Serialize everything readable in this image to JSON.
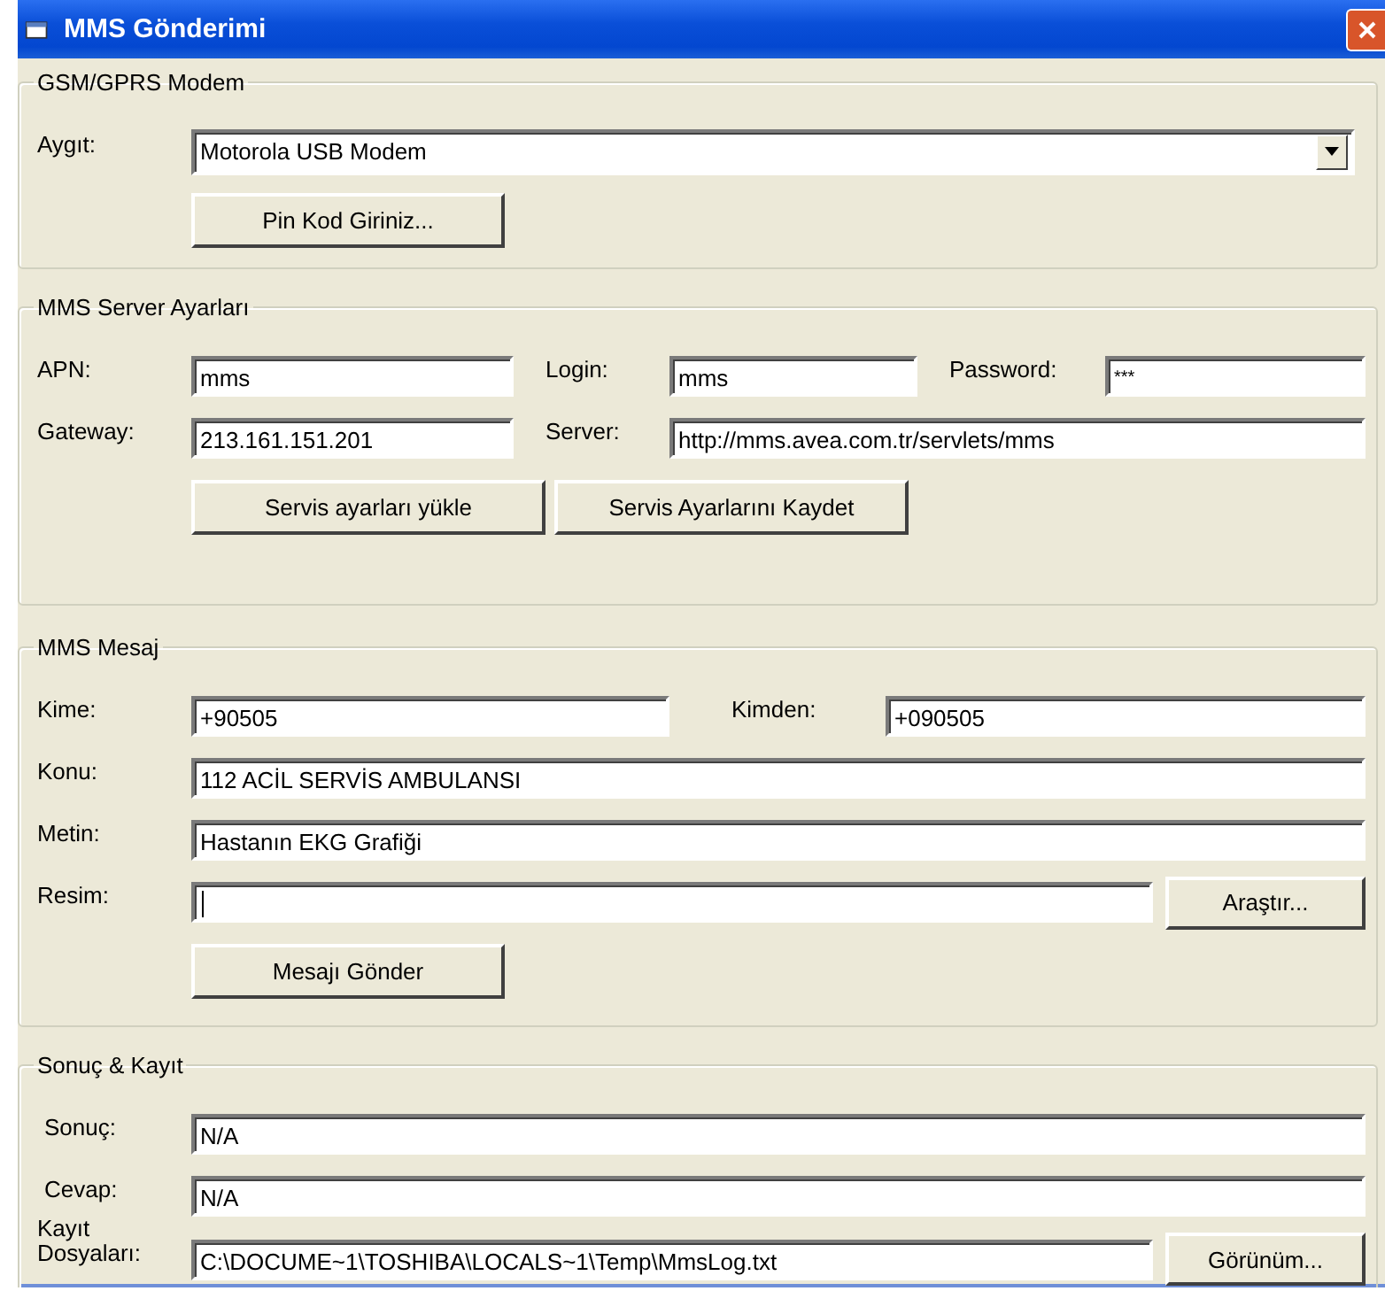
{
  "window": {
    "title": "MMS Gönderimi"
  },
  "modem": {
    "legend": "GSM/GPRS Modem",
    "device_label": "Aygıt:",
    "device_value": "Motorola USB Modem",
    "pin_button": "Pin Kod Giriniz..."
  },
  "server": {
    "legend": "MMS Server Ayarları",
    "apn": {
      "label": "APN:",
      "value": "mms"
    },
    "login": {
      "label": "Login:",
      "value": "mms"
    },
    "password": {
      "label": "Password:",
      "value": "***"
    },
    "gateway": {
      "label": "Gateway:",
      "value": "213.161.151.201"
    },
    "server_url": {
      "label": "Server:",
      "value": "http://mms.avea.com.tr/servlets/mms"
    },
    "buttons": [
      "Servis ayarları yükle",
      "Servis Ayarlarını Kaydet"
    ]
  },
  "message": {
    "legend": "MMS Mesaj",
    "to": {
      "label": "Kime:",
      "value": "+90505"
    },
    "from": {
      "label": "Kimden:",
      "value": "+090505"
    },
    "subject": {
      "label": "Konu:",
      "value": "112 ACİL SERVİS AMBULANSI"
    },
    "text": {
      "label": "Metin:",
      "value": "Hastanın EKG Grafiği"
    },
    "image": {
      "label": "Resim:",
      "focused": true,
      "button": "Araştır..."
    },
    "send_button": "Mesajı Gönder"
  },
  "result": {
    "legend": "Sonuç & Kayıt",
    "result": {
      "label": "Sonuç:",
      "value": "N/A"
    },
    "reply": {
      "label": "Cevap:",
      "value": "N/A"
    },
    "log": {
      "label": "Kayıt Dosyaları:",
      "value": "C:\\DOCUME~1\\TOSHIBA\\LOCALS~1\\Temp\\MmsLog.txt",
      "button": "Görünüm..."
    }
  }
}
